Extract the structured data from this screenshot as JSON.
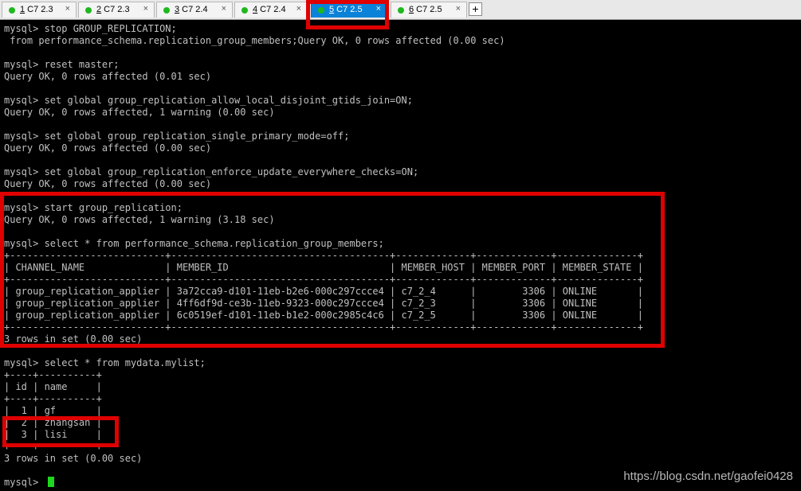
{
  "tabs": [
    {
      "num": "1",
      "title": " C7 2.3"
    },
    {
      "num": "2",
      "title": " C7 2.3"
    },
    {
      "num": "3",
      "title": " C7 2.4"
    },
    {
      "num": "4",
      "title": " C7 2.4"
    },
    {
      "num": "5",
      "title": " C7 2.5"
    },
    {
      "num": "6",
      "title": " C7 2.5"
    }
  ],
  "tab_close": "×",
  "new_tab": "+",
  "colors": {
    "highlight": "#e00000",
    "active_tab": "#0a82d8",
    "status_dot": "#1fb81f"
  },
  "terminal": {
    "lines": [
      "mysql> stop GROUP_REPLICATION;",
      " from performance_schema.replication_group_members;Query OK, 0 rows affected (0.00 sec)",
      "",
      "mysql> reset master;",
      "Query OK, 0 rows affected (0.01 sec)",
      "",
      "mysql> set global group_replication_allow_local_disjoint_gtids_join=ON;",
      "Query OK, 0 rows affected, 1 warning (0.00 sec)",
      "",
      "mysql> set global group_replication_single_primary_mode=off;",
      "Query OK, 0 rows affected (0.00 sec)",
      "",
      "mysql> set global group_replication_enforce_update_everywhere_checks=ON;",
      "Query OK, 0 rows affected (0.00 sec)",
      "",
      "mysql> start group_replication;",
      "Query OK, 0 rows affected, 1 warning (3.18 sec)",
      "",
      "mysql> select * from performance_schema.replication_group_members;",
      "+---------------------------+--------------------------------------+-------------+-------------+--------------+",
      "| CHANNEL_NAME              | MEMBER_ID                            | MEMBER_HOST | MEMBER_PORT | MEMBER_STATE |",
      "+---------------------------+--------------------------------------+-------------+-------------+--------------+",
      "| group_replication_applier | 3a72cca9-d101-11eb-b2e6-000c297ccce4 | c7_2_4      |        3306 | ONLINE       |",
      "| group_replication_applier | 4ff6df9d-ce3b-11eb-9323-000c297ccce4 | c7_2_3      |        3306 | ONLINE       |",
      "| group_replication_applier | 6c0519ef-d101-11eb-b1e2-000c2985c4c6 | c7_2_5      |        3306 | ONLINE       |",
      "+---------------------------+--------------------------------------+-------------+-------------+--------------+",
      "3 rows in set (0.00 sec)",
      "",
      "mysql> select * from mydata.mylist;",
      "+----+----------+",
      "| id | name     |",
      "+----+----------+",
      "|  1 | gf       |",
      "|  2 | zhangsan |",
      "|  3 | lisi     |",
      "+----+----------+",
      "3 rows in set (0.00 sec)",
      "",
      "mysql> "
    ]
  },
  "watermark": "https://blog.csdn.net/gaofei0428"
}
